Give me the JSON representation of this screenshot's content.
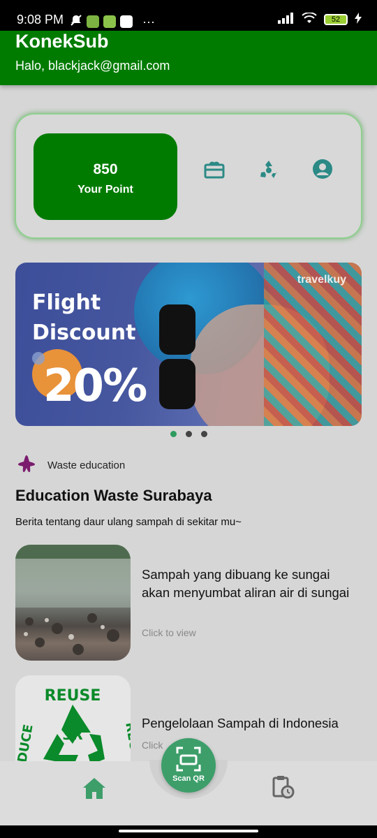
{
  "status_bar": {
    "time": "9:08 PM",
    "battery": "52",
    "more": "···"
  },
  "header": {
    "title": "KonekSub",
    "greeting": "Halo, blackjack@gmail.com",
    "color": "#007b00"
  },
  "point_card": {
    "value": "850",
    "label": "Your Point",
    "actions": [
      "gift-icon",
      "recycle-icon",
      "account-icon"
    ],
    "icon_color": "#2b8a86"
  },
  "banner": {
    "line1": "Flight",
    "line2": "Discount",
    "percent": "20%",
    "brand": "travelkuy",
    "slides": 3,
    "active_slide": 1
  },
  "section": {
    "tag": "Waste education",
    "title": "Education Waste Surabaya",
    "subtitle": "Berita tentang daur ulang sampah di sekitar mu~"
  },
  "news": [
    {
      "title": "Sampah yang dibuang ke sungai akan menyumbat aliran air di sungai",
      "cta": "Click to view"
    },
    {
      "title": "Pengelolaan Sampah di Indonesia",
      "cta": "Click",
      "logo_top": "REUSE",
      "logo_center": "3R",
      "logo_left": "DUCE",
      "logo_right": "REC"
    }
  ],
  "bottom_nav": {
    "scan_label": "Scan QR",
    "accent": "#3d9e6a"
  }
}
